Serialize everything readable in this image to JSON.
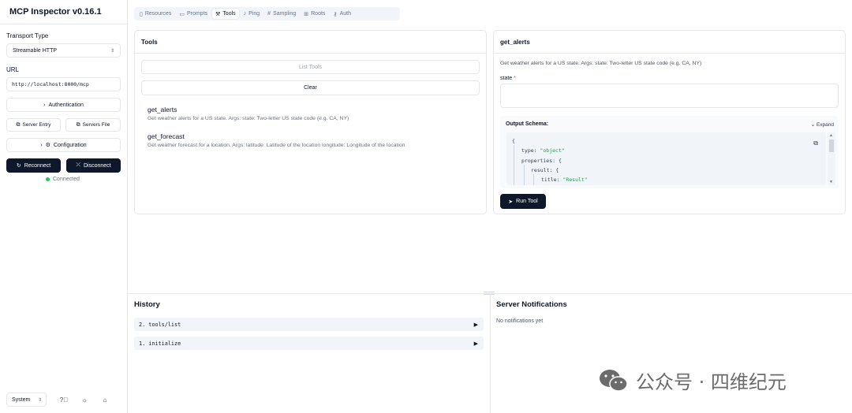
{
  "app": {
    "title": "MCP Inspector v0.16.1"
  },
  "sidebar": {
    "transport_label": "Transport Type",
    "transport_value": "Streamable HTTP",
    "url_label": "URL",
    "url_value": "http://localhost:8000/mcp",
    "authentication": "Authentication",
    "server_entry": "Server Entry",
    "servers_file": "Servers File",
    "configuration": "Configuration",
    "reconnect": "Reconnect",
    "disconnect": "Disconnect",
    "status": "Connected",
    "theme": "System"
  },
  "tabs": [
    {
      "label": "Resources",
      "icon": "file-icon"
    },
    {
      "label": "Prompts",
      "icon": "message-icon"
    },
    {
      "label": "Tools",
      "icon": "wrench-icon"
    },
    {
      "label": "Ping",
      "icon": "bell-icon"
    },
    {
      "label": "Sampling",
      "icon": "hash-icon"
    },
    {
      "label": "Roots",
      "icon": "folder-tree-icon"
    },
    {
      "label": "Auth",
      "icon": "key-icon"
    }
  ],
  "tools_panel": {
    "title": "Tools",
    "list_tools": "List Tools",
    "clear": "Clear",
    "items": [
      {
        "name": "get_alerts",
        "desc": "Get weather alerts for a US state. Args: state: Two-letter US state code (e.g. CA, NY)"
      },
      {
        "name": "get_forecast",
        "desc": "Get weather forecast for a location. Args: latitude: Latitude of the location longitude: Longitude of the location"
      }
    ]
  },
  "detail_panel": {
    "title": "get_alerts",
    "description": "Get weather alerts for a US state. Args: state: Two-letter US state code (e.g. CA, NY)",
    "param_label": "state",
    "required_mark": "*",
    "schema_title": "Output Schema:",
    "expand": "Expand",
    "code": {
      "l1": "{",
      "l2_key": "type: ",
      "l2_val": "\"object\"",
      "l3": "properties: {",
      "l4": "result: {",
      "l5_key": "title: ",
      "l5_val": "\"Result\""
    },
    "run_tool": "Run Tool"
  },
  "history": {
    "title": "History",
    "items": [
      "2. tools/list",
      "1. initialize"
    ]
  },
  "notifications": {
    "title": "Server Notifications",
    "empty": "No notifications yet"
  },
  "watermark": {
    "text": "公众号 · 四维纪元"
  }
}
